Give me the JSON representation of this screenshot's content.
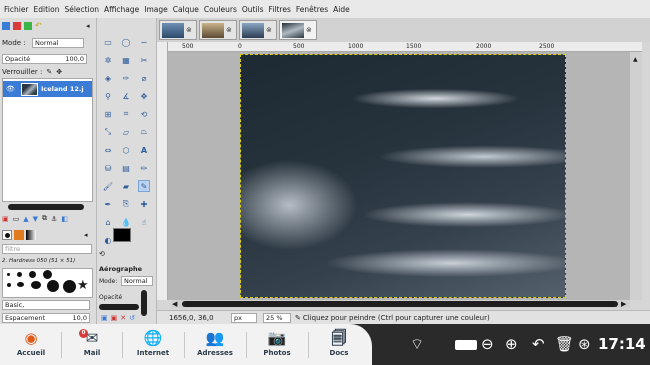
{
  "menu": [
    "Fichier",
    "Edition",
    "Sélection",
    "Affichage",
    "Image",
    "Calque",
    "Couleurs",
    "Outils",
    "Filtres",
    "Fenêtres",
    "Aide"
  ],
  "layers": {
    "mode_label": "Mode :",
    "mode_value": "Normal",
    "opacity_label": "Opacité",
    "opacity_value": "100,0",
    "lock_label": "Verrouiller :",
    "layer_name": "Iceland 12.j"
  },
  "brushes": {
    "filter_placeholder": "filtre",
    "brush_name": "2. Hardness 050 (51 × 51)",
    "preset": "Basic,",
    "spacing_label": "Espacement",
    "spacing_value": "10,0"
  },
  "tool_options": {
    "title": "Aérographe",
    "mode_label": "Mode:",
    "mode_value": "Normal",
    "opacity_label": "Opacité"
  },
  "ruler": {
    "marks": [
      "500",
      "0",
      "500",
      "1000",
      "1500",
      "2000",
      "2500"
    ]
  },
  "status": {
    "coords": "1656,0, 36,0",
    "unit": "px",
    "zoom": "25 %",
    "message": "Cliquez pour peindre (Ctrl pour capturer une couleur)"
  },
  "taskbar": {
    "apps": [
      "Accueil",
      "Mail",
      "Internet",
      "Adresses",
      "Photos",
      "Docs"
    ],
    "mail_badge": "0",
    "time": "17:14"
  },
  "colors": {
    "accent": "#3a7bd5",
    "taskbar": "#2a2a2a",
    "launcher": "#f2f2f2"
  }
}
